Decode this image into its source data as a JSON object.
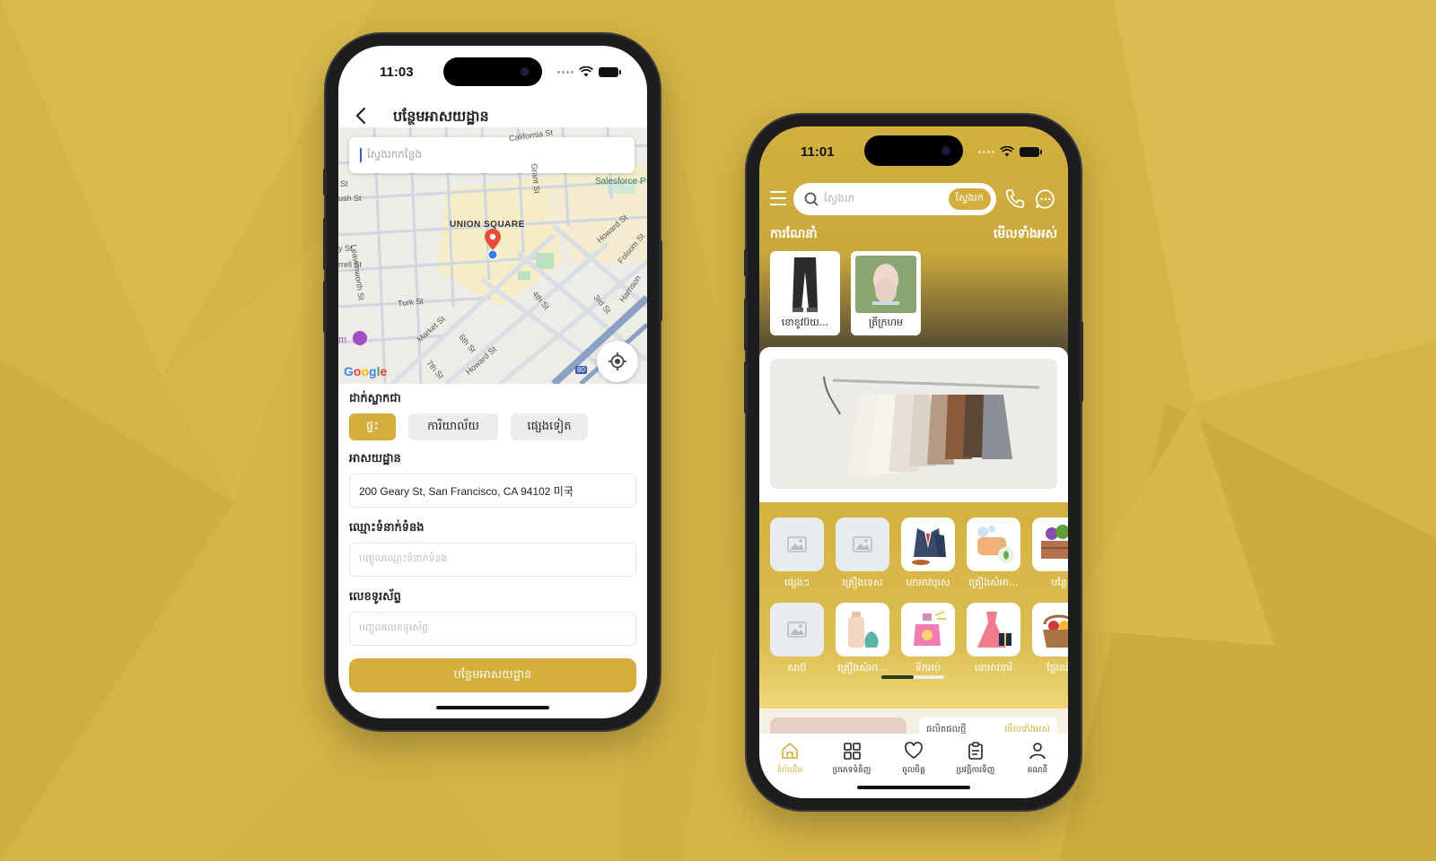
{
  "theme": {
    "accent": "#d4ae3b",
    "background": "#d4b445"
  },
  "left_screen": {
    "status_time": "11:03",
    "title": "បន្ថែមអាសយដ្ឋាន",
    "map": {
      "search_placeholder": "ស្វែងរកកន្លែង",
      "labels": {
        "union_square": "UNION SQUARE",
        "salesforce": "Salesforce P",
        "california": "California St",
        "leavenworth": "Leavenworth St",
        "turk": "Turk St",
        "market": "Market St",
        "howard_1": "Howard St",
        "howard_2": "Howard St",
        "folsom": "Folsom St",
        "harrison": "Harrison",
        "fourth": "4th St",
        "third": "3rd St",
        "sixth": "6th St",
        "seventh": "7th St",
        "grant": "Grant St",
        "bush": "ush St",
        "st_1": "St",
        "st_2": "y St",
        "farrell": "rrell St",
        "highway": "80",
        "m_label": "m"
      },
      "attribution": "Google"
    },
    "form": {
      "type_label": "ដាក់ស្លាកជា",
      "types": [
        "ផ្ទះ",
        "ការិយាល័យ",
        "ផ្សេងទៀត"
      ],
      "selected_type": "ផ្ទះ",
      "address_label": "អាសយដ្ឋាន",
      "address_value": "200 Geary St, San Francisco, CA 94102 미국",
      "contact_label": "ឈ្មោះទំនាក់ទំនង",
      "contact_placeholder": "បញ្ចូលឈ្មោះទំនាក់ទំនង",
      "phone_label": "លេខទូរស័ព្ទ",
      "phone_placeholder": "បញ្ចូលលេខទូរស័ព្ទ",
      "submit_label": "បន្ថែមអាសយដ្ឋាន"
    }
  },
  "right_screen": {
    "status_time": "11:01",
    "search": {
      "placeholder": "ស្វែងរក",
      "button": "ស្វែងរក"
    },
    "recommended": {
      "title": "ការណែនាំ",
      "view_all": "មើលទាំងអស់",
      "items": [
        {
          "caption": "ខោខូវប៊យ...",
          "icon": "jeans-image"
        },
        {
          "caption": "ត្រីក្រហម",
          "icon": "fish-image"
        }
      ]
    },
    "categories": {
      "row1": [
        {
          "label": "ផ្សេងៗ",
          "icon": "placeholder-image-icon"
        },
        {
          "label": "គ្រឿងទេស",
          "icon": "placeholder-image-icon"
        },
        {
          "label": "ខោអាវបុរស",
          "icon": "suit-icon"
        },
        {
          "label": "គ្រឿងសំអា...",
          "icon": "soap-icon"
        },
        {
          "label": "បន្លែ",
          "icon": "vegetable-crate-icon"
        }
      ],
      "row2": [
        {
          "label": "សាប៊",
          "icon": "placeholder-image-icon"
        },
        {
          "label": "គ្រឿងសំអា...",
          "icon": "lotion-icon"
        },
        {
          "label": "ទឹកអប់",
          "icon": "perfume-icon"
        },
        {
          "label": "ខោអាវនារី",
          "icon": "dress-icon"
        },
        {
          "label": "ផ្លែឈើ",
          "icon": "fruit-basket-icon"
        }
      ]
    },
    "products_peek": {
      "title": "ផលិតផលថ្មី",
      "view_all": "មើលទាំងអស់"
    },
    "tabs": [
      {
        "label": "ទំព័រដើម",
        "icon": "home-icon",
        "active": true
      },
      {
        "label": "ប្រភេទទំនិញ",
        "icon": "grid-icon",
        "active": false
      },
      {
        "label": "ចូលចិត្ត",
        "icon": "heart-icon",
        "active": false
      },
      {
        "label": "ប្រវត្តិការទិញ",
        "icon": "clipboard-icon",
        "active": false
      },
      {
        "label": "គណនី",
        "icon": "user-icon",
        "active": false
      }
    ]
  }
}
